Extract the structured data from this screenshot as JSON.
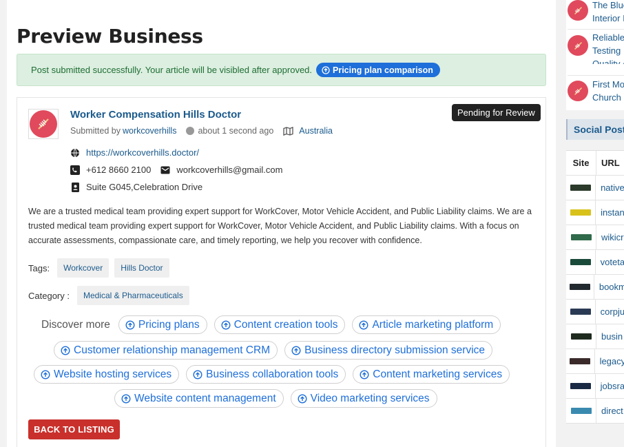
{
  "page": {
    "title": "Preview Business"
  },
  "alert": {
    "text": "Post submitted successfully. Your article will be visibled after approved.",
    "pill_label": "Pricing plan comparison"
  },
  "business": {
    "name": "Worker Compensation Hills Doctor",
    "submitted_by_prefix": "Submitted by",
    "submitted_by_user": "workcoverhills",
    "time": "about 1 second ago",
    "location": "Australia",
    "status": "Pending for Review",
    "website": "https://workcoverhills.doctor/",
    "phone": "+612 8660 2100",
    "email": "workcoverhills@gmail.com",
    "address": "Suite G045,Celebration Drive",
    "description": "We are a trusted medical team providing expert support for WorkCover, Motor Vehicle Accident, and Public Liability claims. We are a trusted medical team providing expert support for WorkCover, Motor Vehicle Accident, and Public Liability claims. With a focus on accurate assessments, compassionate care, and timely reporting, we help you recover with confidence."
  },
  "tags": {
    "label": "Tags:",
    "items": [
      "Workcover",
      "Hills Doctor"
    ]
  },
  "category": {
    "label": "Category :",
    "value": "Medical & Pharmaceuticals"
  },
  "discover": {
    "label": "Discover more",
    "links": [
      "Pricing plans",
      "Content creation tools",
      "Article marketing platform",
      "Customer relationship management CRM",
      "Business directory submission service",
      "Website hosting services",
      "Business collaboration tools",
      "Content marketing services",
      "Website content management",
      "Video marketing services"
    ]
  },
  "back_button": "BACK TO LISTING",
  "sidebar": {
    "related": [
      {
        "lines": [
          "The Blue",
          "Interior I"
        ]
      },
      {
        "lines": [
          "Reliable",
          "Testing",
          "Quality A"
        ]
      },
      {
        "lines": [
          "First Mo",
          "Church"
        ]
      }
    ],
    "social_heading": "Social Post",
    "table": {
      "headers": [
        "Site",
        "URL"
      ],
      "rows": [
        {
          "url": "native",
          "thumb_color": "#2b3a2a"
        },
        {
          "url": "instan",
          "thumb_color": "#d8c21a"
        },
        {
          "url": "wikicr",
          "thumb_color": "#2f6a4a"
        },
        {
          "url": "voteta",
          "thumb_color": "#1a4a3a"
        },
        {
          "url": "bookm",
          "thumb_color": "#222a30"
        },
        {
          "url": "corpju",
          "thumb_color": "#2a3a55"
        },
        {
          "url": "busin",
          "thumb_color": "#1f2a1f"
        },
        {
          "url": "legacy",
          "thumb_color": "#3a2a2a"
        },
        {
          "url": "jobsra",
          "thumb_color": "#1a2a44"
        },
        {
          "url": "direct",
          "thumb_color": "#3a8ab0"
        }
      ]
    }
  }
}
